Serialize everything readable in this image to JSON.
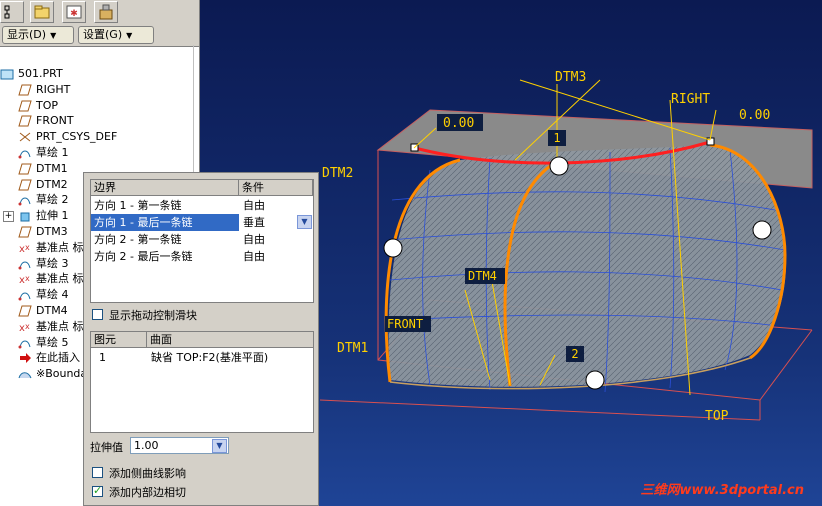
{
  "toolbar": {
    "show_label": "显示(D)",
    "settings_label": "设置(G)"
  },
  "tree": {
    "items": [
      {
        "label": "501.PRT",
        "icon": "part-icon"
      },
      {
        "label": "RIGHT",
        "icon": "datum-plane-icon"
      },
      {
        "label": "TOP",
        "icon": "datum-plane-icon"
      },
      {
        "label": "FRONT",
        "icon": "datum-plane-icon"
      },
      {
        "label": "PRT_CSYS_DEF",
        "icon": "csys-icon"
      },
      {
        "label": "草绘 1",
        "icon": "sketch-icon"
      },
      {
        "label": "DTM1",
        "icon": "datum-plane-icon"
      },
      {
        "label": "DTM2",
        "icon": "datum-plane-icon"
      },
      {
        "label": "草绘 2",
        "icon": "sketch-icon"
      },
      {
        "label": "拉伸 1",
        "icon": "extrude-icon"
      },
      {
        "label": "DTM3",
        "icon": "datum-plane-icon"
      },
      {
        "label": "基准点 标",
        "icon": "datum-point-icon"
      },
      {
        "label": "草绘 3",
        "icon": "sketch-icon"
      },
      {
        "label": "基准点 标",
        "icon": "datum-point-icon"
      },
      {
        "label": "草绘 4",
        "icon": "sketch-icon"
      },
      {
        "label": "DTM4",
        "icon": "datum-plane-icon"
      },
      {
        "label": "基准点 标",
        "icon": "datum-point-icon"
      },
      {
        "label": "草绘 5",
        "icon": "sketch-icon"
      },
      {
        "label": "在此插入",
        "icon": "insert-arrow-icon"
      },
      {
        "label": "※Bounda",
        "icon": "boundary-blend-icon"
      }
    ]
  },
  "dialog": {
    "boundary_header": "边界",
    "condition_header": "条件",
    "rows": [
      {
        "boundary": "方向 1 - 第一条链",
        "condition": "自由"
      },
      {
        "boundary": "方向 1 - 最后一条链",
        "condition": "垂直"
      },
      {
        "boundary": "方向 2 - 第一条链",
        "condition": "自由"
      },
      {
        "boundary": "方向 2 - 最后一条链",
        "condition": "自由"
      }
    ],
    "show_drag_label": "显示拖动控制滑块",
    "entity_header": "图元",
    "surface_header": "曲面",
    "entity_row": {
      "entity": "1",
      "surface": "缺省 TOP:F2(基准平面)"
    },
    "extrude_label": "拉伸值",
    "extrude_value": "1.00",
    "side_curve_label": "添加侧曲线影响",
    "inner_edge_label": "添加内部边相切"
  },
  "viewport": {
    "labels": {
      "dtm3": "DTM3",
      "right": "RIGHT",
      "dim_left": "0.00",
      "dim_right": "0.00",
      "dtm2": "DTM2",
      "tag1": "1",
      "tag2": "2",
      "dtm4": "DTM4",
      "front": "FRONT",
      "dtm1": "DTM1",
      "top": "TOP"
    },
    "watermark": "三维网www.3dportal.cn"
  },
  "colors": {
    "selection": "#316ac5",
    "curve_red": "#ff2020",
    "curve_orange": "#ff8a00",
    "surface": "#a0a8b0",
    "datum": "#ffd000"
  }
}
